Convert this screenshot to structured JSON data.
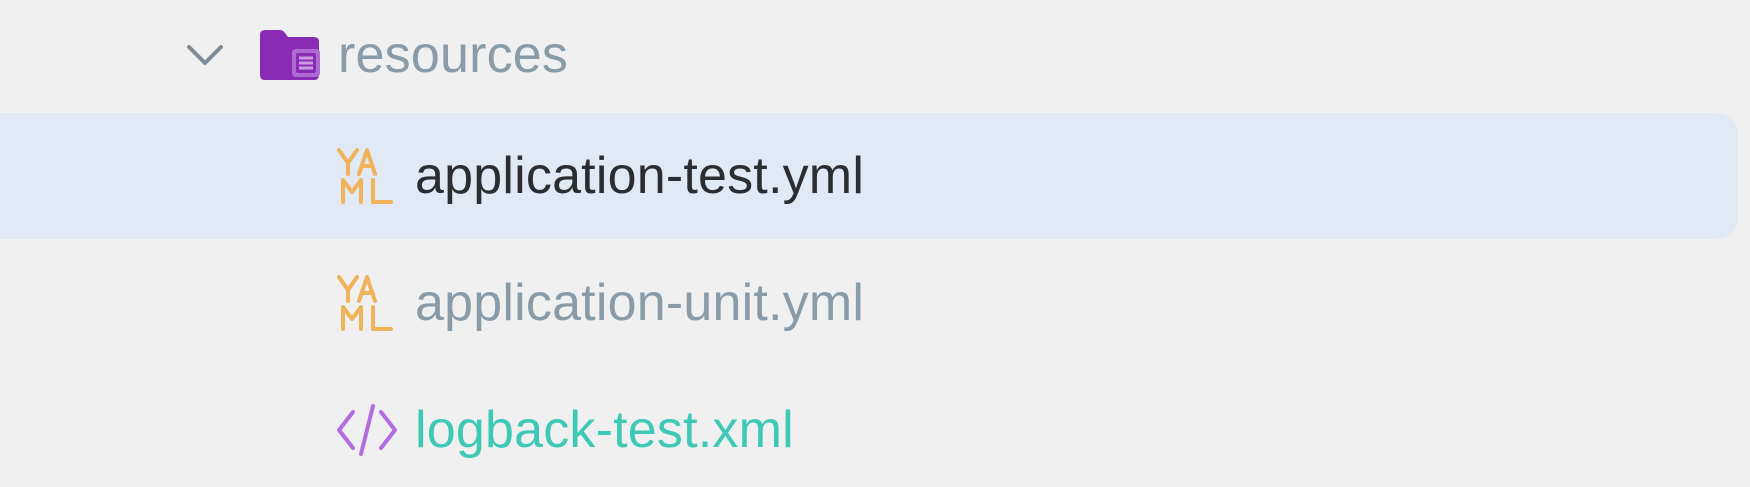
{
  "tree": {
    "folder": {
      "name": "resources",
      "icon": "resource-folder-icon",
      "expanded": true,
      "label_color": "#8a9ba8",
      "icon_color": "#8a2bb3"
    },
    "files": [
      {
        "name": "application-test.yml",
        "icon": "yaml-file-icon",
        "selected": true,
        "label_color": "#2b2d30",
        "icon_color": "#f0b35a"
      },
      {
        "name": "application-unit.yml",
        "icon": "yaml-file-icon",
        "selected": false,
        "label_color": "#8a9ba8",
        "icon_color": "#f0b35a"
      },
      {
        "name": "logback-test.xml",
        "icon": "xml-file-icon",
        "selected": false,
        "label_color": "#3ec9b6",
        "icon_color": "#b26ee0"
      }
    ],
    "selection_color": "#e0e9f4"
  }
}
